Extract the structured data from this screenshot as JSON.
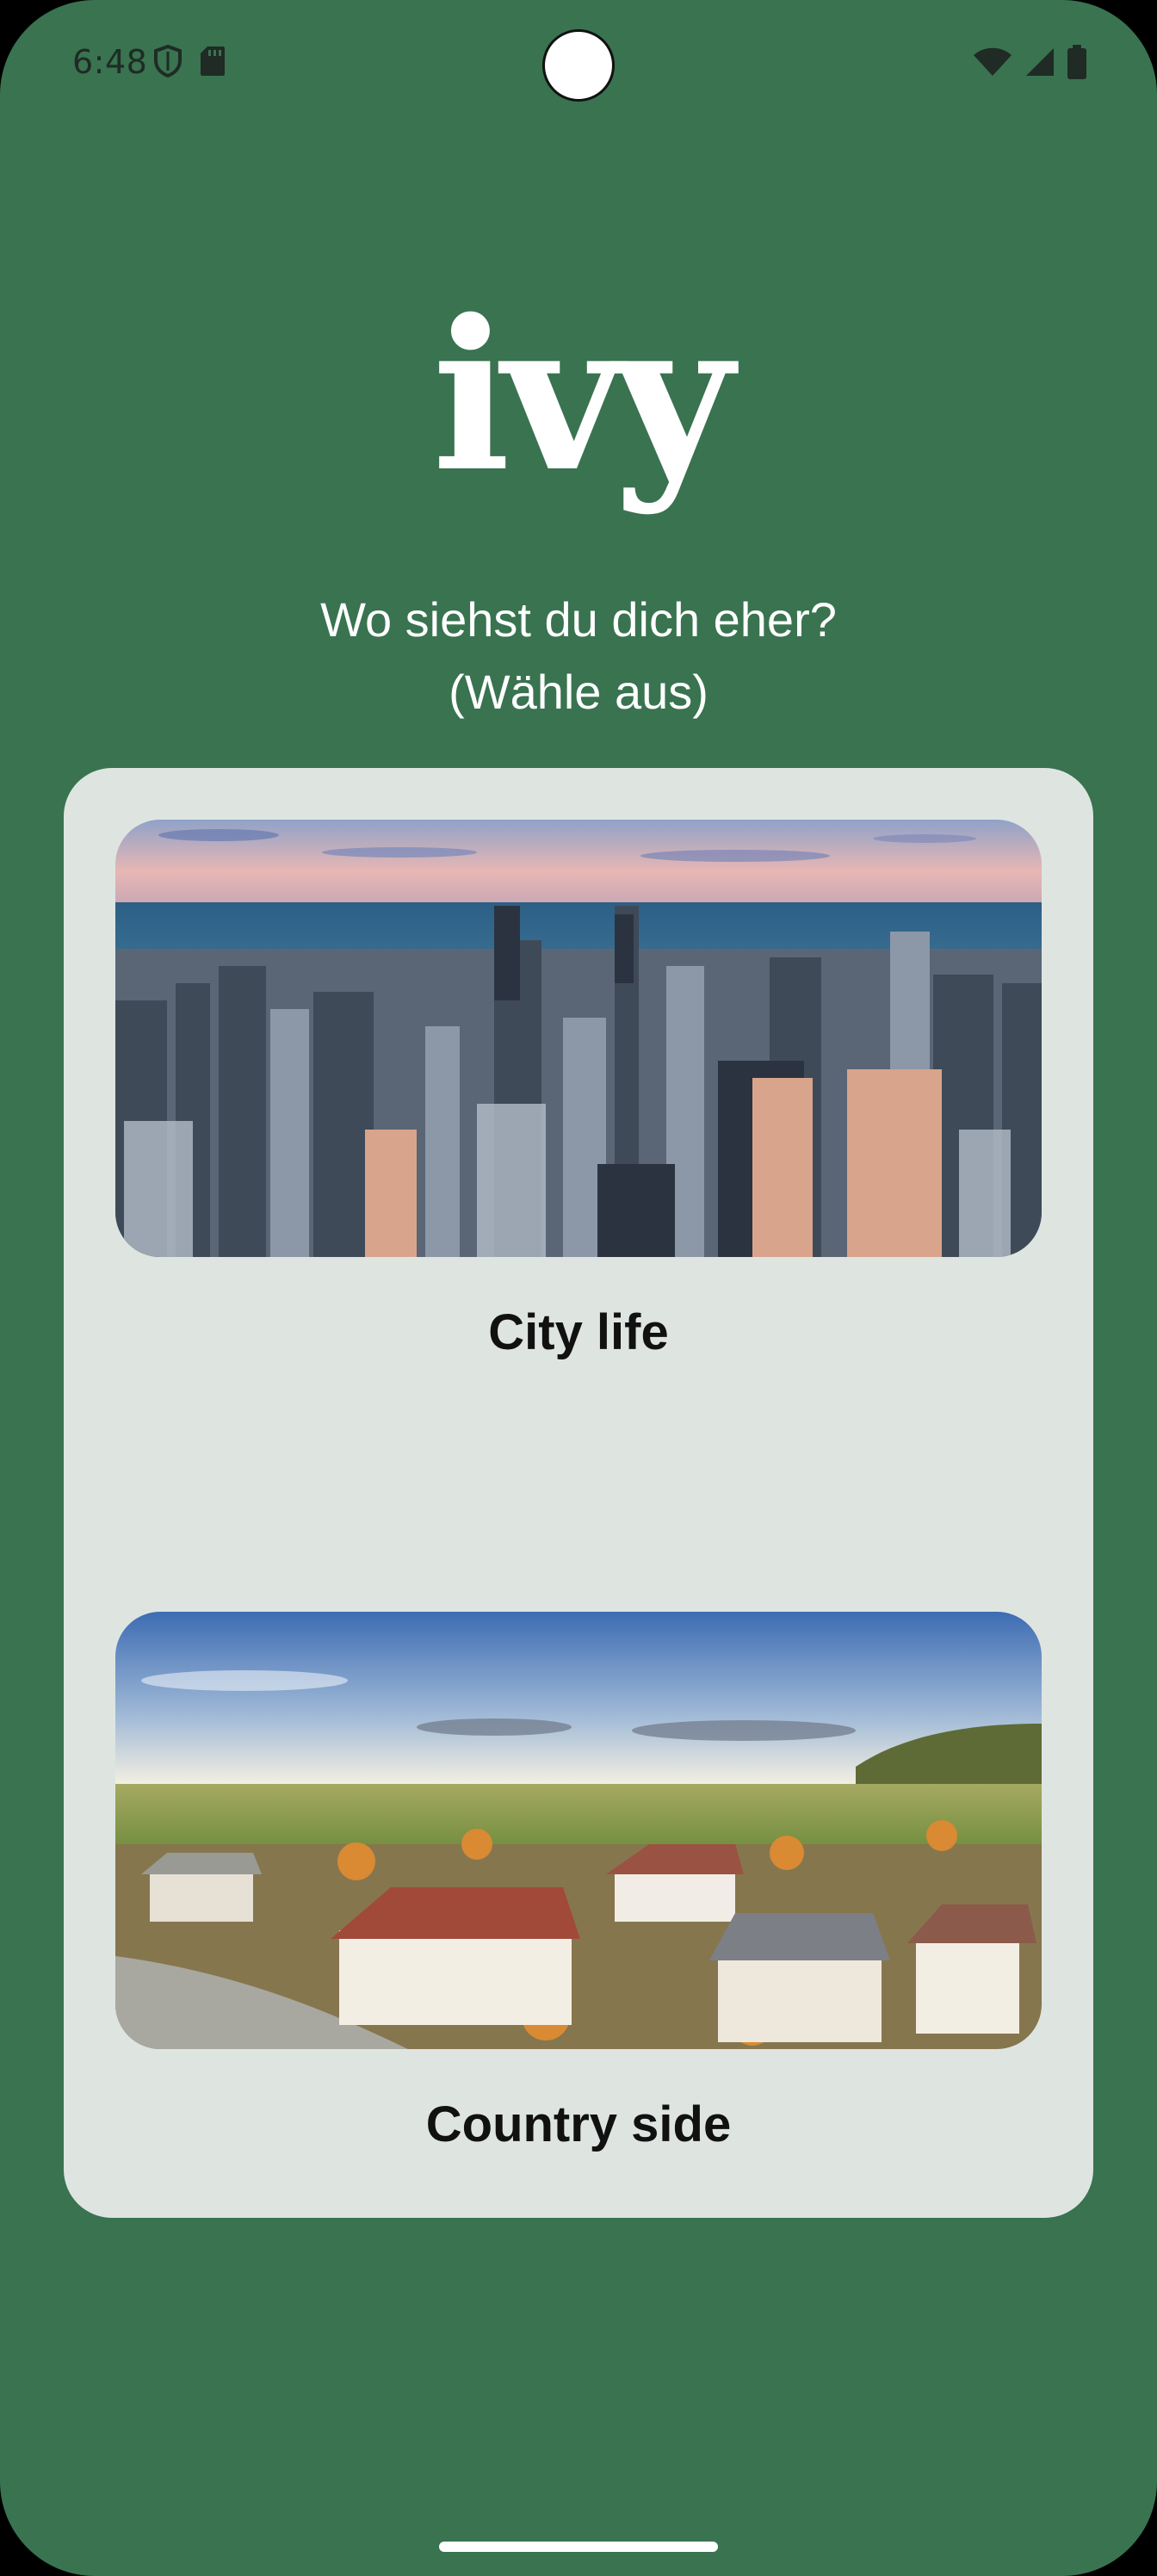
{
  "status_bar": {
    "time": "6:48",
    "left_icons": [
      "shield-icon",
      "sd-card-icon"
    ],
    "right_icons": [
      "wifi-icon",
      "cellular-signal-icon",
      "battery-icon"
    ]
  },
  "logo": {
    "text": "ivy"
  },
  "prompt": {
    "line1": "Wo siehst du dich eher?",
    "line2": "(Wähle aus)"
  },
  "options": [
    {
      "label": "City life",
      "image": "city-skyline-photo"
    },
    {
      "label": "Country side",
      "image": "countryside-village-photo"
    }
  ],
  "colors": {
    "background": "#397350",
    "card": "#dee5e1",
    "text_light": "#ffffff",
    "text_dark": "#111111"
  }
}
